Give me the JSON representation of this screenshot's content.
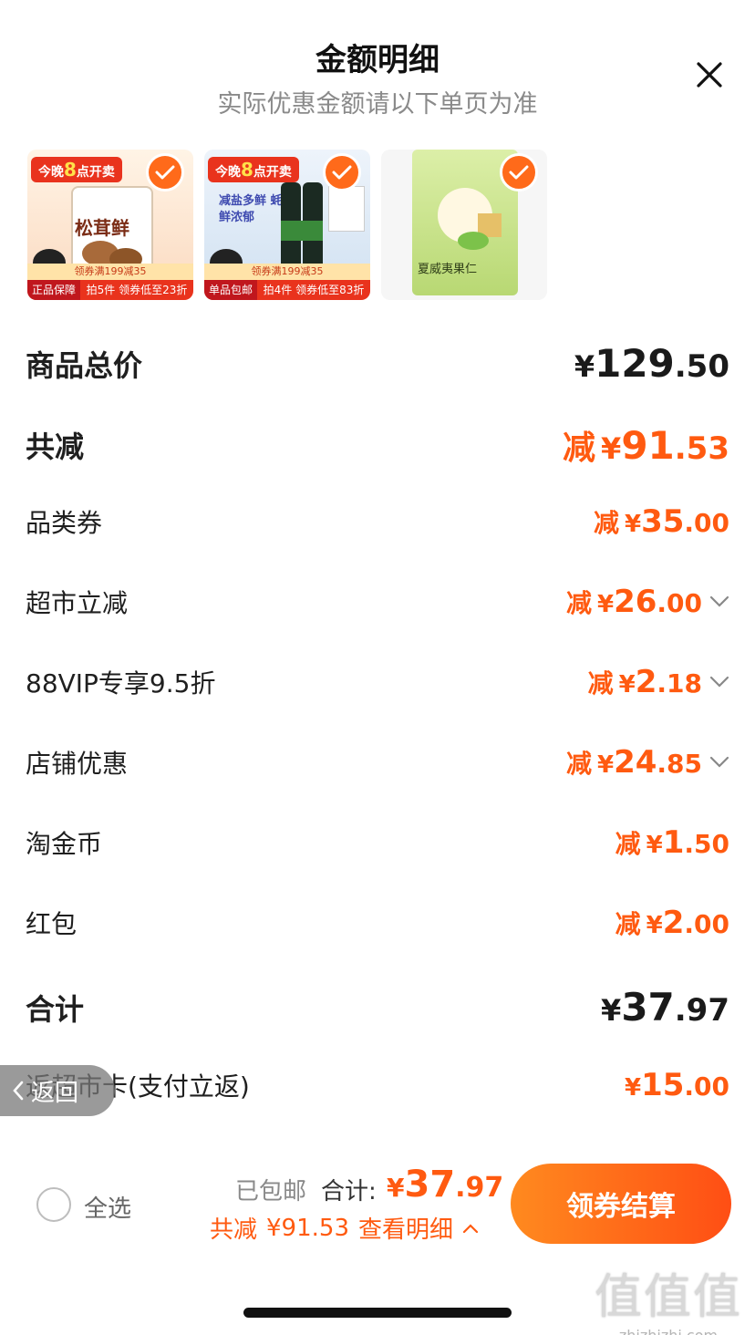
{
  "header": {
    "title": "金额明细",
    "subtitle": "实际优惠金额请以下单页为准",
    "close_icon": "close-icon"
  },
  "products": [
    {
      "promo_a": "今晚",
      "promo_num": "8",
      "promo_b": "点开卖",
      "name": "松茸鲜",
      "band1": "领券满199减35",
      "tag": "正品保障",
      "deal": "拍5件 领券低至23折",
      "checked": true,
      "bg": "#fde7d2"
    },
    {
      "promo_a": "今晚",
      "promo_num": "8",
      "promo_b": "点开卖",
      "name": "减盐多鲜 蚝鲜浓郁",
      "band1": "领券满199减35",
      "tag": "单品包邮",
      "deal": "拍4件 领券低至83折",
      "checked": true,
      "bg": "#dfe9f6"
    },
    {
      "name": "夏威夷果仁",
      "checked": true,
      "bg": "#cfe59a"
    }
  ],
  "rows": [
    {
      "label": "商品总价",
      "prefix": "",
      "yen": "¥",
      "int": "129",
      "dec": ".50",
      "style": "total",
      "chevron": false
    },
    {
      "label": "共减",
      "prefix": "减",
      "yen": "¥",
      "int": "91",
      "dec": ".53",
      "style": "reduce-big",
      "chevron": false
    },
    {
      "label": "品类券",
      "prefix": "减",
      "yen": "¥",
      "int": "35",
      "dec": ".00",
      "style": "reduce",
      "chevron": false
    },
    {
      "label": "超市立减",
      "prefix": "减",
      "yen": "¥",
      "int": "26",
      "dec": ".00",
      "style": "reduce",
      "chevron": true
    },
    {
      "label": "88VIP专享9.5折",
      "prefix": "减",
      "yen": "¥",
      "int": "2",
      "dec": ".18",
      "style": "reduce",
      "chevron": true
    },
    {
      "label": "店铺优惠",
      "prefix": "减",
      "yen": "¥",
      "int": "24",
      "dec": ".85",
      "style": "reduce",
      "chevron": true
    },
    {
      "label": "淘金币",
      "prefix": "减",
      "yen": "¥",
      "int": "1",
      "dec": ".50",
      "style": "reduce",
      "chevron": false
    },
    {
      "label": "红包",
      "prefix": "减",
      "yen": "¥",
      "int": "2",
      "dec": ".00",
      "style": "reduce",
      "chevron": false
    },
    {
      "label": "合计",
      "prefix": "",
      "yen": "¥",
      "int": "37",
      "dec": ".97",
      "style": "total",
      "chevron": false
    },
    {
      "label": "返超市卡(支付立返)",
      "prefix": "",
      "yen": "¥",
      "int": "15",
      "dec": ".00",
      "style": "reduce",
      "chevron": false
    }
  ],
  "back": {
    "label": "返回"
  },
  "bottom_bar": {
    "select_all": "全选",
    "shipping": "已包邮",
    "total_label": "合计:",
    "total_yen": "¥",
    "total_int": "37",
    "total_dec": ".97",
    "savings_label": "共减",
    "savings_amount": "¥91.53",
    "detail_link": "查看明细",
    "checkout": "领券结算"
  },
  "watermark": {
    "big": "值值值",
    "small": "zhizhizhi.com"
  },
  "colors": {
    "accent": "#ff5a10",
    "checkout_start": "#ff8a1f",
    "checkout_end": "#ff4e14"
  }
}
